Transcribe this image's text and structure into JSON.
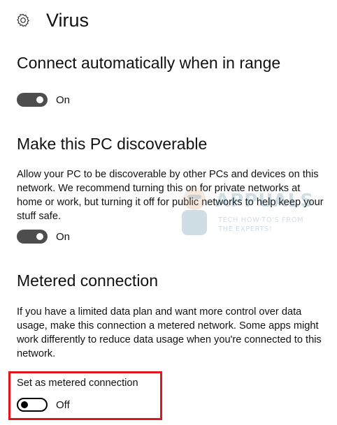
{
  "header": {
    "icon": "gear-icon",
    "title": "Virus"
  },
  "connect_auto": {
    "title": "Connect automatically when in range",
    "toggle": {
      "state_label": "On",
      "checked": true
    }
  },
  "discoverable": {
    "title": "Make this PC discoverable",
    "description": "Allow your PC to be discoverable by other PCs and devices on this network. We recommend turning this on for private networks at home or work, but turning it off for public networks to help keep your stuff safe.",
    "toggle": {
      "state_label": "On",
      "checked": true
    }
  },
  "metered": {
    "title": "Metered connection",
    "description": "If you have a limited data plan and want more control over data usage, make this connection a metered network. Some apps might work differently to reduce data usage when you're connected to this network.",
    "setting_label": "Set as metered connection",
    "toggle": {
      "state_label": "Off",
      "checked": false
    }
  },
  "watermark": {
    "brand": "APPUALS",
    "tagline_1": "TECH HOW-TO'S FROM",
    "tagline_2": "THE EXPERTS!"
  },
  "colors": {
    "highlight": "#e0161b",
    "toggle_on": "#4d4d4d"
  }
}
